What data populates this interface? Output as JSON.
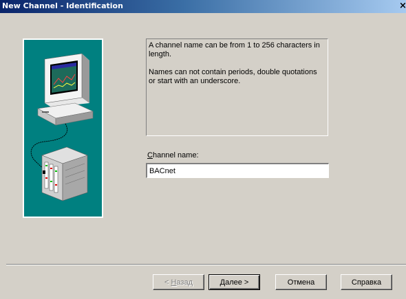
{
  "window": {
    "title": "New Channel - Identification",
    "close_glyph": "×"
  },
  "info": {
    "line1": "A channel name can be from 1 to 256 characters in length.",
    "line2": "Names can not contain periods, double quotations or start with an underscore."
  },
  "field": {
    "label_accel": "C",
    "label_rest": "hannel name:",
    "value": "BACnet"
  },
  "buttons": {
    "back_prefix": "< ",
    "back_accel": "Н",
    "back_rest": "азад",
    "next_accel": "Д",
    "next_rest": "алее >",
    "cancel": "Отмена",
    "help": "Справка"
  },
  "colors": {
    "dialog_bg": "#d4d0c8",
    "illustration_bg": "#008080",
    "title_start": "#0a246a",
    "title_end": "#a6caf0"
  },
  "icons": [
    "computer-icon",
    "plc-device-icon"
  ]
}
